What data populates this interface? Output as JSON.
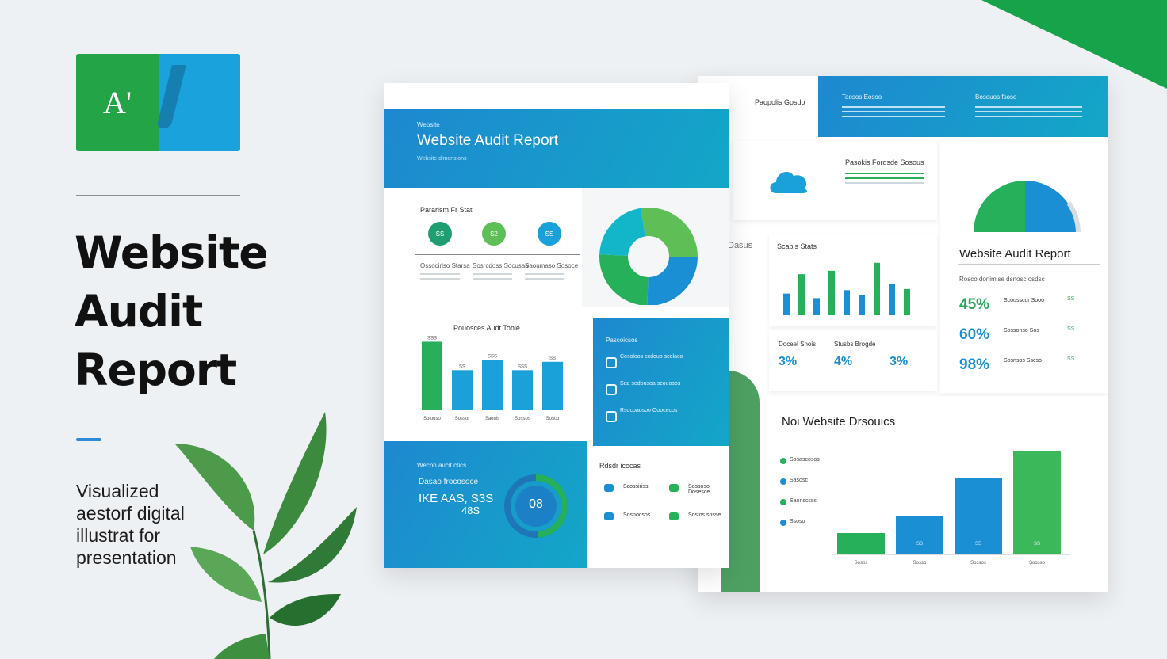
{
  "hero": {
    "logo_text": "A'",
    "title_lines": [
      "Website",
      "Audit",
      "Report"
    ],
    "subtitle_lines": [
      "Visualized",
      "aestorf digital",
      "illustrat for",
      "presentation"
    ]
  },
  "front_page": {
    "header_kicker": "Website",
    "header_title": "Website Audit Report",
    "header_note": "Website dimensions",
    "section1_title": "Pararism Fr Stat",
    "circle_labels": [
      "SS",
      "S2",
      "SS"
    ],
    "col_titles": [
      "Ossocirlso Starsa",
      "Sosrcdoss Socusas",
      "Saoumaso Sosoce"
    ],
    "bars_title": "Pouosces Audt Toble",
    "bars_chart": {
      "values": [
        82,
        48,
        60,
        48,
        58
      ],
      "colors": [
        "#26b05a",
        "#1aa1d9",
        "#1aa1d9",
        "#1aa1d9",
        "#1aa1d9"
      ],
      "value_labels": [
        "SSS",
        "SS",
        "SSS",
        "SSS",
        "SS"
      ],
      "x_labels": [
        "Solouso",
        "Sossor",
        "Saouls",
        "Sossos",
        "Sosco"
      ]
    },
    "panel_title": "Pascoicsos",
    "panel_items": [
      "Cosoloos ccdouo scolaco",
      "Sqa sedousoa scouosos",
      "Rsocoaosoo Ooocecos"
    ],
    "bottom_kicker": "Wecnn aucit ctics",
    "bottom_line1": "Dasao frocosoce",
    "bottom_line2": "IKE AAS, S3S",
    "bottom_line3": "48S",
    "gauge_value": "08",
    "list_title": "Rdsdr icocas",
    "list_items": [
      "Scossiriss",
      "Sossoso Dosesce",
      "Sosnocsos",
      "Soslos sosse"
    ]
  },
  "back_page": {
    "top_title": "Paopolis Gosdo",
    "top_cols": [
      "Taosos Eosoo",
      "Bosouos fsoso"
    ],
    "section_a": "Pasokis Fordsde Sosous",
    "dashs": "Dasus",
    "stats_title": "Scabis Stats",
    "stats_chart": {
      "values": [
        38,
        72,
        30,
        78,
        44,
        36,
        92,
        55,
        46
      ],
      "colors": [
        "#1a8fd4",
        "#26b05a",
        "#1a8fd4",
        "#26b05a",
        "#1a8fd4",
        "#1a8fd4",
        "#26b05a",
        "#1a8fd4",
        "#26b05a"
      ]
    },
    "mini_stats": [
      [
        "Doceel Shois",
        "3%"
      ],
      [
        "Stusbs Brogde",
        "4%"
      ],
      [
        "",
        "3%"
      ]
    ],
    "report_title": "Website Audit Report",
    "report_note": "Rosco donimlse dsnosc osdsc",
    "pcts": [
      {
        "v": "45%",
        "label": "Scousscor Sooo",
        "small": "SS"
      },
      {
        "v": "60%",
        "label": "Sossonso Sos",
        "small": "SS"
      },
      {
        "v": "98%",
        "label": "Sosnsos Sscso",
        "small": "SS"
      }
    ],
    "pct_colors": [
      "#26a65b",
      "#1a8fd4",
      "#1a8fd4"
    ],
    "big_title": "Noi Website Drsouics",
    "big_chart": {
      "values": [
        27,
        48,
        96,
        130
      ],
      "colors": [
        "#26b05a",
        "#1a8fd4",
        "#1a8fd4",
        "#3ab85a"
      ],
      "x_labels": [
        "Sosos",
        "Sosso",
        "Sossos",
        "Soosso"
      ],
      "bar_labels": [
        "",
        "SS",
        "SS",
        "SS"
      ]
    },
    "left_legend": [
      "Sosascosos",
      "Sasosc",
      "Saonscsss",
      "Ssoso"
    ]
  }
}
